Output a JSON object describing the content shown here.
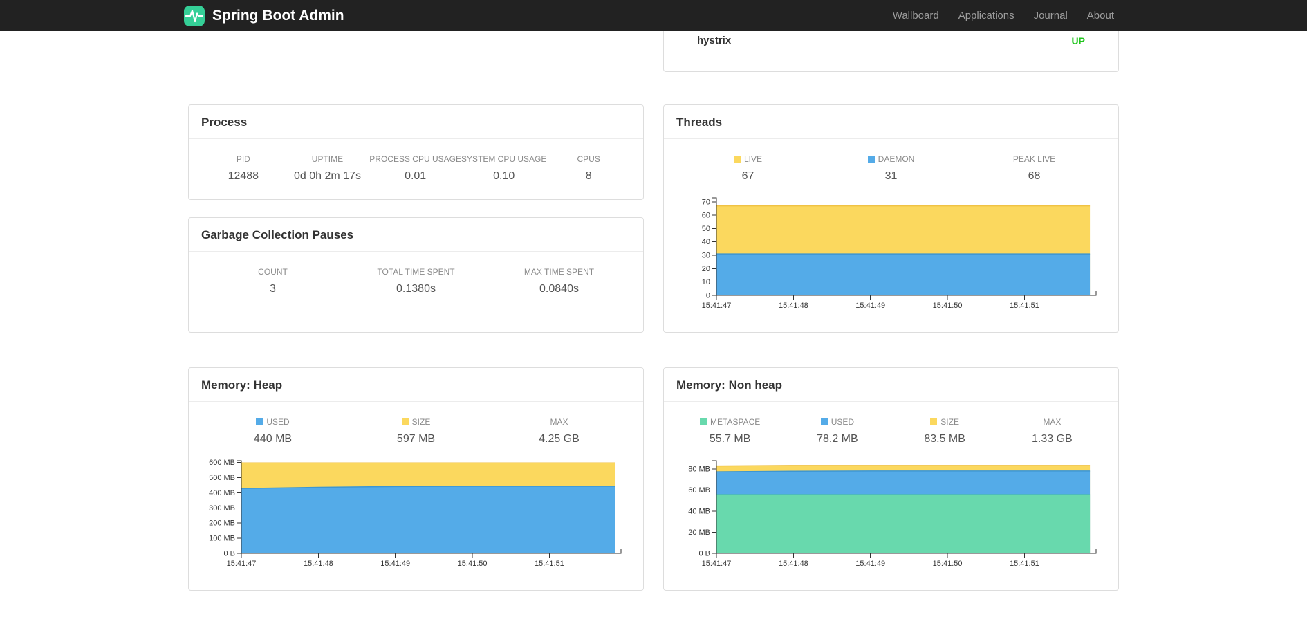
{
  "navbar": {
    "brand": "Spring Boot Admin",
    "links": [
      {
        "label": "Wallboard"
      },
      {
        "label": "Applications"
      },
      {
        "label": "Journal"
      },
      {
        "label": "About"
      }
    ]
  },
  "application_status": {
    "name": "hystrix",
    "status": "UP",
    "status_color": "#21c51e"
  },
  "cards": {
    "process": {
      "title": "Process",
      "metrics": [
        {
          "label": "PID",
          "value": "12488"
        },
        {
          "label": "UPTIME",
          "value": "0d 0h 2m 17s"
        },
        {
          "label": "PROCESS CPU USAGE",
          "value": "0.01"
        },
        {
          "label": "SYSTEM CPU USAGE",
          "value": "0.10"
        },
        {
          "label": "CPUS",
          "value": "8"
        }
      ]
    },
    "gc": {
      "title": "Garbage Collection Pauses",
      "metrics": [
        {
          "label": "COUNT",
          "value": "3"
        },
        {
          "label": "TOTAL TIME SPENT",
          "value": "0.1380s"
        },
        {
          "label": "MAX TIME SPENT",
          "value": "0.0840s"
        }
      ]
    },
    "threads": {
      "title": "Threads",
      "legend": [
        {
          "label": "LIVE",
          "value": "67",
          "color": "#fbd85e"
        },
        {
          "label": "DAEMON",
          "value": "31",
          "color": "#54abe8"
        },
        {
          "label": "PEAK LIVE",
          "value": "68"
        }
      ]
    },
    "memory_heap": {
      "title": "Memory: Heap",
      "legend": [
        {
          "label": "USED",
          "value": "440 MB",
          "color": "#54abe8"
        },
        {
          "label": "SIZE",
          "value": "597 MB",
          "color": "#fbd85e"
        },
        {
          "label": "MAX",
          "value": "4.25 GB"
        }
      ]
    },
    "memory_nonheap": {
      "title": "Memory: Non heap",
      "legend": [
        {
          "label": "METASPACE",
          "value": "55.7 MB",
          "color": "#68d9ad"
        },
        {
          "label": "USED",
          "value": "78.2 MB",
          "color": "#54abe8"
        },
        {
          "label": "SIZE",
          "value": "83.5 MB",
          "color": "#fbd85e"
        },
        {
          "label": "MAX",
          "value": "1.33 GB"
        }
      ]
    }
  },
  "chart_data": [
    {
      "id": "threads",
      "type": "area",
      "title": "Threads",
      "xlabel": "",
      "ylabel": "",
      "x_labels": [
        "15:41:47",
        "15:41:48",
        "15:41:49",
        "15:41:50",
        "15:41:51"
      ],
      "t": [
        0,
        1,
        2,
        3,
        4,
        4.85
      ],
      "ylim": [
        0,
        73
      ],
      "y_ticks": [
        {
          "v": 0,
          "label": "0"
        },
        {
          "v": 10,
          "label": "10"
        },
        {
          "v": 20,
          "label": "20"
        },
        {
          "v": 30,
          "label": "30"
        },
        {
          "v": 40,
          "label": "40"
        },
        {
          "v": 50,
          "label": "50"
        },
        {
          "v": 60,
          "label": "60"
        },
        {
          "v": 70,
          "label": "70"
        }
      ],
      "note": "series painted in listed order; later series overlay earlier (stacked look)",
      "series": [
        {
          "name": "LIVE",
          "color": "#fbd85e",
          "line": "#f0c244",
          "values": [
            67,
            67,
            67,
            67,
            67,
            67
          ]
        },
        {
          "name": "DAEMON",
          "color": "#54abe8",
          "line": "#3d96d2",
          "values": [
            31,
            31,
            31,
            31,
            31,
            31
          ]
        }
      ],
      "legend_position": "top",
      "grid": false
    },
    {
      "id": "memory-heap",
      "type": "area",
      "title": "Memory: Heap",
      "xlabel": "",
      "ylabel": "",
      "x_labels": [
        "15:41:47",
        "15:41:48",
        "15:41:49",
        "15:41:50",
        "15:41:51"
      ],
      "t": [
        0,
        1,
        2,
        3,
        4,
        4.85
      ],
      "ylim": [
        0,
        612
      ],
      "y_ticks": [
        {
          "v": 0,
          "label": "0 B"
        },
        {
          "v": 100,
          "label": "100 MB"
        },
        {
          "v": 200,
          "label": "200 MB"
        },
        {
          "v": 300,
          "label": "300 MB"
        },
        {
          "v": 400,
          "label": "400 MB"
        },
        {
          "v": 500,
          "label": "500 MB"
        },
        {
          "v": 600,
          "label": "600 MB"
        }
      ],
      "note": "values in MB; series painted in listed order",
      "series": [
        {
          "name": "SIZE",
          "color": "#fbd85e",
          "line": "#f0c244",
          "values": [
            597,
            597,
            597,
            597,
            597,
            597
          ]
        },
        {
          "name": "USED",
          "color": "#54abe8",
          "line": "#3d96d2",
          "values": [
            428,
            436,
            441,
            443,
            443,
            443
          ]
        }
      ],
      "legend_position": "top",
      "grid": false
    },
    {
      "id": "memory-nonheap",
      "type": "area",
      "title": "Memory: Non heap",
      "xlabel": "",
      "ylabel": "",
      "x_labels": [
        "15:41:47",
        "15:41:48",
        "15:41:49",
        "15:41:50",
        "15:41:51"
      ],
      "t": [
        0,
        1,
        2,
        3,
        4,
        4.85
      ],
      "ylim": [
        0,
        88
      ],
      "y_ticks": [
        {
          "v": 0,
          "label": "0 B"
        },
        {
          "v": 20,
          "label": "20 MB"
        },
        {
          "v": 40,
          "label": "40 MB"
        },
        {
          "v": 60,
          "label": "60 MB"
        },
        {
          "v": 80,
          "label": "80 MB"
        }
      ],
      "note": "values in MB; series painted in listed order",
      "series": [
        {
          "name": "SIZE",
          "color": "#fbd85e",
          "line": "#f0c244",
          "values": [
            83.0,
            83.5,
            83.5,
            83.5,
            83.5,
            83.5
          ]
        },
        {
          "name": "USED",
          "color": "#54abe8",
          "line": "#3d96d2",
          "values": [
            77.4,
            78.0,
            78.2,
            78.2,
            78.2,
            78.2
          ]
        },
        {
          "name": "METASPACE",
          "color": "#68d9ad",
          "line": "#46c795",
          "values": [
            55.7,
            55.7,
            55.7,
            55.7,
            55.7,
            55.7
          ]
        }
      ],
      "legend_position": "top",
      "grid": false
    }
  ]
}
